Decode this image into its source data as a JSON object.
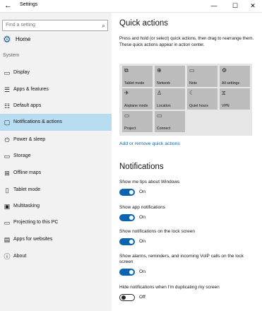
{
  "window": {
    "title": "Settings",
    "back_glyph": "←",
    "min_glyph": "—",
    "max_glyph": "☐",
    "close_glyph": "✕"
  },
  "sidebar": {
    "search_placeholder": "Find a setting",
    "home_label": "Home",
    "section_header": "System",
    "items": [
      {
        "label": "Display",
        "icon": "display-icon",
        "glyph": "▭"
      },
      {
        "label": "Apps & features",
        "icon": "apps-icon",
        "glyph": "☰"
      },
      {
        "label": "Default apps",
        "icon": "default-apps-icon",
        "glyph": "☷"
      },
      {
        "label": "Notifications & actions",
        "icon": "notifications-icon",
        "glyph": "▢",
        "active": true
      },
      {
        "label": "Power & sleep",
        "icon": "power-icon",
        "glyph": "⏻"
      },
      {
        "label": "Storage",
        "icon": "storage-icon",
        "glyph": "▭"
      },
      {
        "label": "Offline maps",
        "icon": "map-icon",
        "glyph": "⊞"
      },
      {
        "label": "Tablet mode",
        "icon": "tablet-icon",
        "glyph": "▯"
      },
      {
        "label": "Multitasking",
        "icon": "multitasking-icon",
        "glyph": "▣"
      },
      {
        "label": "Projecting to this PC",
        "icon": "projecting-icon",
        "glyph": "▭"
      },
      {
        "label": "Apps for websites",
        "icon": "apps-for-websites-icon",
        "glyph": "▤"
      },
      {
        "label": "About",
        "icon": "info-icon",
        "glyph": "ⓘ"
      }
    ]
  },
  "main": {
    "quick_actions_title": "Quick actions",
    "quick_actions_desc": "Press and hold (or select) quick actions, then drag to rearrange them. These quick actions appear in action center.",
    "tiles": [
      {
        "label": "Tablet mode",
        "icon": "tablet-mode-icon",
        "glyph": "⧉"
      },
      {
        "label": "Network",
        "icon": "network-icon",
        "glyph": "⊕"
      },
      {
        "label": "Note",
        "icon": "note-icon",
        "glyph": "▭"
      },
      {
        "label": "All settings",
        "icon": "all-settings-icon",
        "glyph": "⚙"
      },
      {
        "label": "Airplane mode",
        "icon": "airplane-icon",
        "glyph": "✈"
      },
      {
        "label": "Location",
        "icon": "location-icon",
        "glyph": "♙"
      },
      {
        "label": "Quiet hours",
        "icon": "quiet-hours-icon",
        "glyph": "☾"
      },
      {
        "label": "VPN",
        "icon": "vpn-icon",
        "glyph": "⧖"
      },
      {
        "label": "Project",
        "icon": "project-icon",
        "glyph": "▭"
      },
      {
        "label": "Connect",
        "icon": "connect-icon",
        "glyph": "▭"
      }
    ],
    "add_remove_link": "Add or remove quick actions",
    "notifications_title": "Notifications",
    "settings": [
      {
        "label": "Show me tips about Windows",
        "state": "On",
        "on": true
      },
      {
        "label": "Show app notifications",
        "state": "On",
        "on": true
      },
      {
        "label": "Show notifications on the lock screen",
        "state": "On",
        "on": true
      },
      {
        "label": "Show alarms, reminders, and incoming VoIP calls on the lock screen",
        "state": "On",
        "on": true
      },
      {
        "label": "Hide notifications when I'm duplicating my screen",
        "state": "Off",
        "on": false
      }
    ]
  },
  "colors": {
    "accent": "#0a64b0",
    "sidebar_bg": "#f2f2f2",
    "active_bg": "#b8dcf0",
    "tile_bg": "#bcbcbc"
  }
}
